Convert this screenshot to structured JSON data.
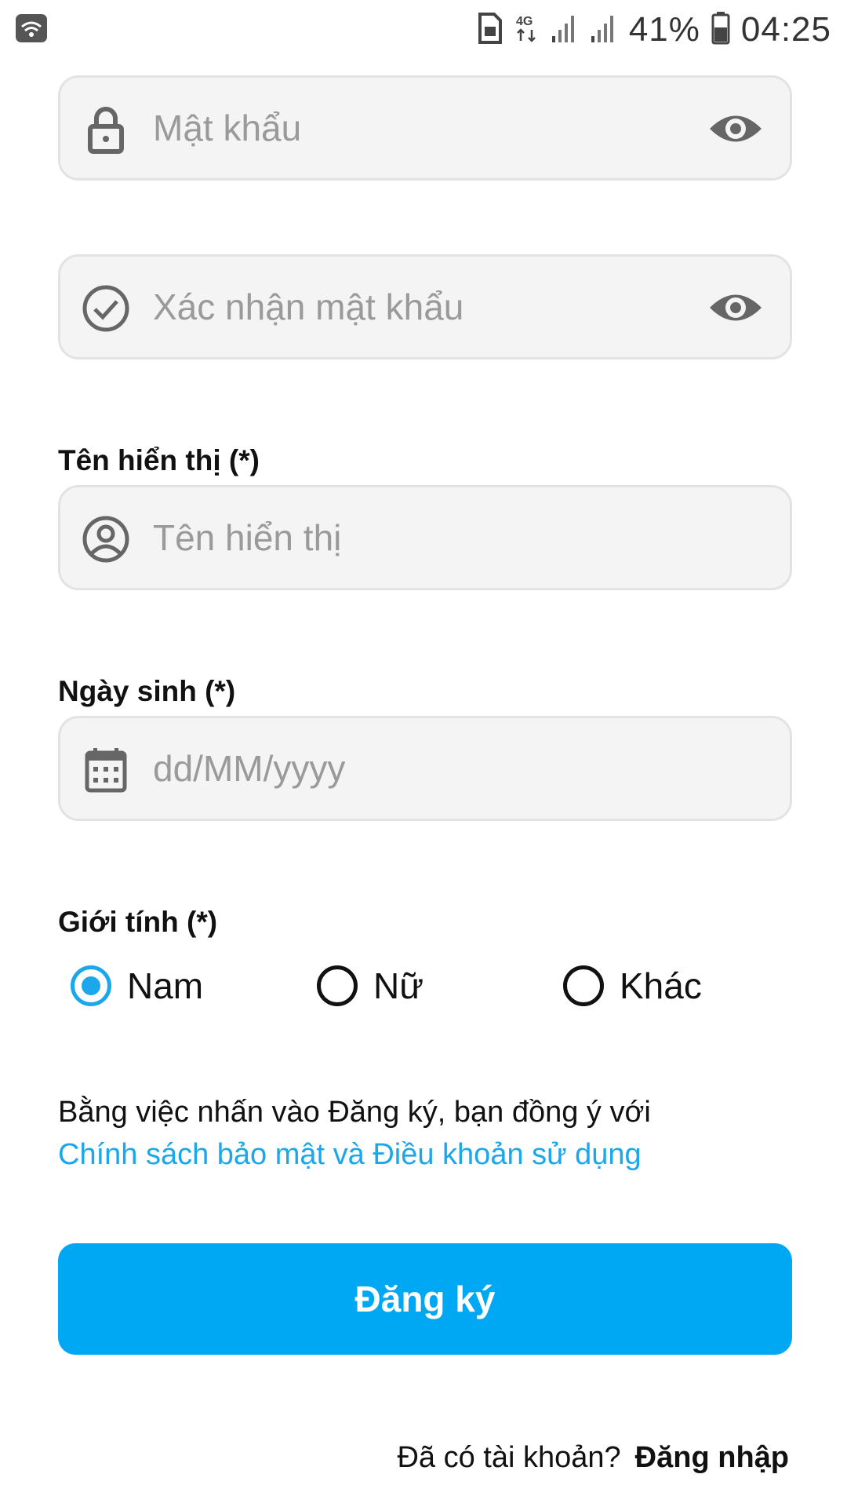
{
  "status_bar": {
    "battery": "41%",
    "time": "04:25",
    "network": "4G",
    "icons": [
      "wifi-icon",
      "sim-icon",
      "network-4g-icon",
      "signal-icon",
      "signal-icon",
      "battery-icon"
    ]
  },
  "form": {
    "password": {
      "placeholder": "Mật khẩu",
      "lead_icon": "lock-icon",
      "trail_icon": "eye-icon"
    },
    "confirm_password": {
      "placeholder": "Xác nhận mật khẩu",
      "lead_icon": "check-circle-icon",
      "trail_icon": "eye-icon"
    },
    "display_name": {
      "label": "Tên hiển thị (*)",
      "placeholder": "Tên hiển thị",
      "lead_icon": "user-circle-icon"
    },
    "birthday": {
      "label": "Ngày sinh (*)",
      "placeholder": "dd/MM/yyyy",
      "lead_icon": "calendar-icon"
    },
    "gender": {
      "label": "Giới tính (*)",
      "options": [
        "Nam",
        "Nữ",
        "Khác"
      ],
      "selected": "Nam"
    }
  },
  "terms": {
    "text": "Bằng việc nhấn vào Đăng ký, bạn đồng ý với",
    "link": "Chính sách bảo mật và Điều khoản sử dụng"
  },
  "submit_label": "Đăng ký",
  "login": {
    "prompt": "Đã có tài khoản?",
    "link": "Đăng nhập"
  },
  "colors": {
    "accent": "#00a8f3",
    "field_bg": "#f4f4f4",
    "placeholder": "#9a9a9a"
  }
}
